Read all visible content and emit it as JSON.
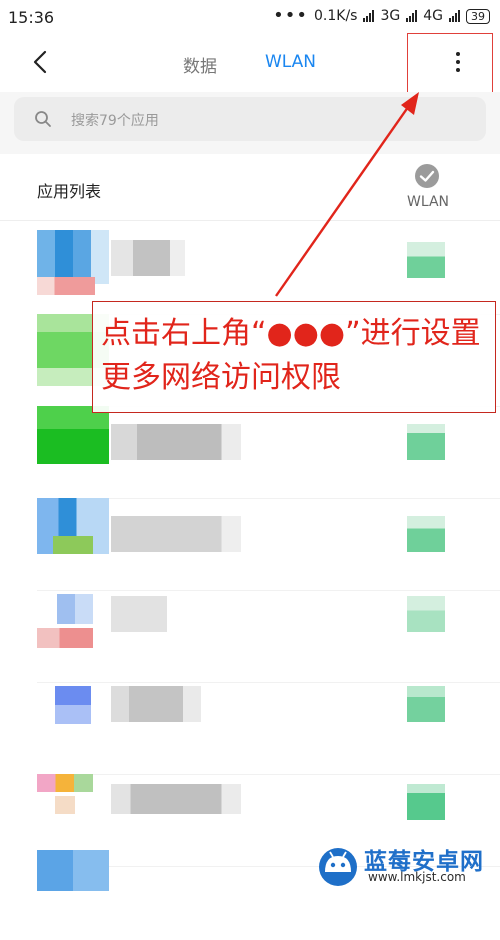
{
  "status_bar": {
    "time": "15:36",
    "dots": "•••",
    "speed": "0.1K/s",
    "network1": "3G",
    "network2": "4G",
    "battery": "39"
  },
  "header": {
    "tab_data": "数据",
    "tab_wlan": "WLAN",
    "back_icon": "chevron-left-icon",
    "more_icon": "vertical-dots-icon"
  },
  "search": {
    "placeholder": "搜索79个应用",
    "icon": "search-icon"
  },
  "list": {
    "title": "应用列表",
    "column_label": "WLAN",
    "column_icon": "check-circle-icon"
  },
  "annotation": {
    "text": "点击右上角“●●●”进行设置更多网络访问权限"
  },
  "watermark": {
    "title": "蓝莓安卓网",
    "url": "www.lmkjst.com"
  },
  "colors": {
    "accent": "#1a86f0",
    "annotation_red": "#e1251b",
    "toggle_green": "#3dc57e"
  }
}
